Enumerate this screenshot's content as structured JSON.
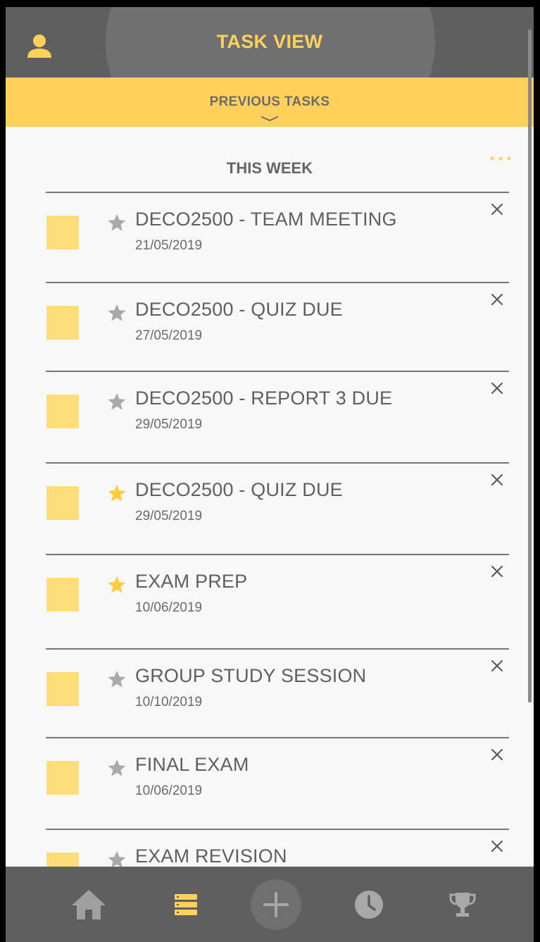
{
  "header": {
    "title": "TASK VIEW",
    "user_icon": "user-icon"
  },
  "previous": {
    "label": "PREVIOUS TASKS",
    "icon": "chevron-down-icon"
  },
  "section": {
    "title": "THIS WEEK",
    "menu_icon": "more-horizontal-icon"
  },
  "colors": {
    "accent": "#ffd15c",
    "dark_bar": "#5f5f5f",
    "checkbox": "#ffdd7a",
    "star_off": "#a9a9a9",
    "star_on": "#ffcc3d"
  },
  "tasks": [
    {
      "name": "DECO2500 - TEAM MEETING",
      "date": "21/05/2019",
      "starred": false
    },
    {
      "name": "DECO2500 - QUIZ DUE",
      "date": "27/05/2019",
      "starred": false
    },
    {
      "name": "DECO2500 - REPORT 3 DUE",
      "date": "29/05/2019",
      "starred": false
    },
    {
      "name": "DECO2500 - QUIZ DUE",
      "date": "29/05/2019",
      "starred": true
    },
    {
      "name": "EXAM PREP",
      "date": "10/06/2019",
      "starred": true
    },
    {
      "name": "GROUP STUDY SESSION",
      "date": "10/10/2019",
      "starred": false
    },
    {
      "name": "FINAL EXAM",
      "date": "10/06/2019",
      "starred": false
    },
    {
      "name": "EXAM REVISION",
      "date": "",
      "starred": false
    }
  ],
  "nav": {
    "items": [
      {
        "icon": "home-icon",
        "active": false
      },
      {
        "icon": "task-list-icon",
        "active": true
      },
      {
        "icon": "add-icon",
        "active": false
      },
      {
        "icon": "clock-icon",
        "active": false
      },
      {
        "icon": "trophy-icon",
        "active": false
      }
    ]
  }
}
